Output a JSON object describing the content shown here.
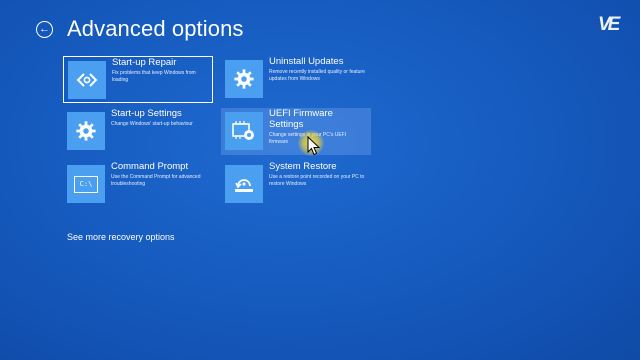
{
  "header": {
    "back_icon": "back-arrow-icon",
    "title": "Advanced options"
  },
  "brand": {
    "logo_text": "VE"
  },
  "tiles": [
    {
      "name": "Start-up Repair",
      "description": "Fix problems that keep Windows from loading",
      "icon": "code-brackets-icon"
    },
    {
      "name": "Uninstall Updates",
      "description": "Remove recently installed quality or feature updates from Windows",
      "icon": "gear-icon"
    },
    {
      "name": "Start-up Settings",
      "description": "Change Windows' start-up behaviour",
      "icon": "gear-icon"
    },
    {
      "name": "UEFI Firmware Settings",
      "description": "Change settings in your PC's UEFI firmware",
      "icon": "chip-gear-icon"
    },
    {
      "name": "Command Prompt",
      "description": "Use the Command Prompt for advanced troubleshooting",
      "icon": "command-prompt-icon",
      "icon_text": "C:\\"
    },
    {
      "name": "System Restore",
      "description": "Use a restore point recorded on your PC to restore Windows",
      "icon": "restore-icon"
    }
  ],
  "footer": {
    "more_link": "See more recovery options"
  },
  "colors": {
    "background": "#1559bd",
    "icon_tile": "#4a9ff0",
    "cursor_highlight": "#ffe23c"
  }
}
